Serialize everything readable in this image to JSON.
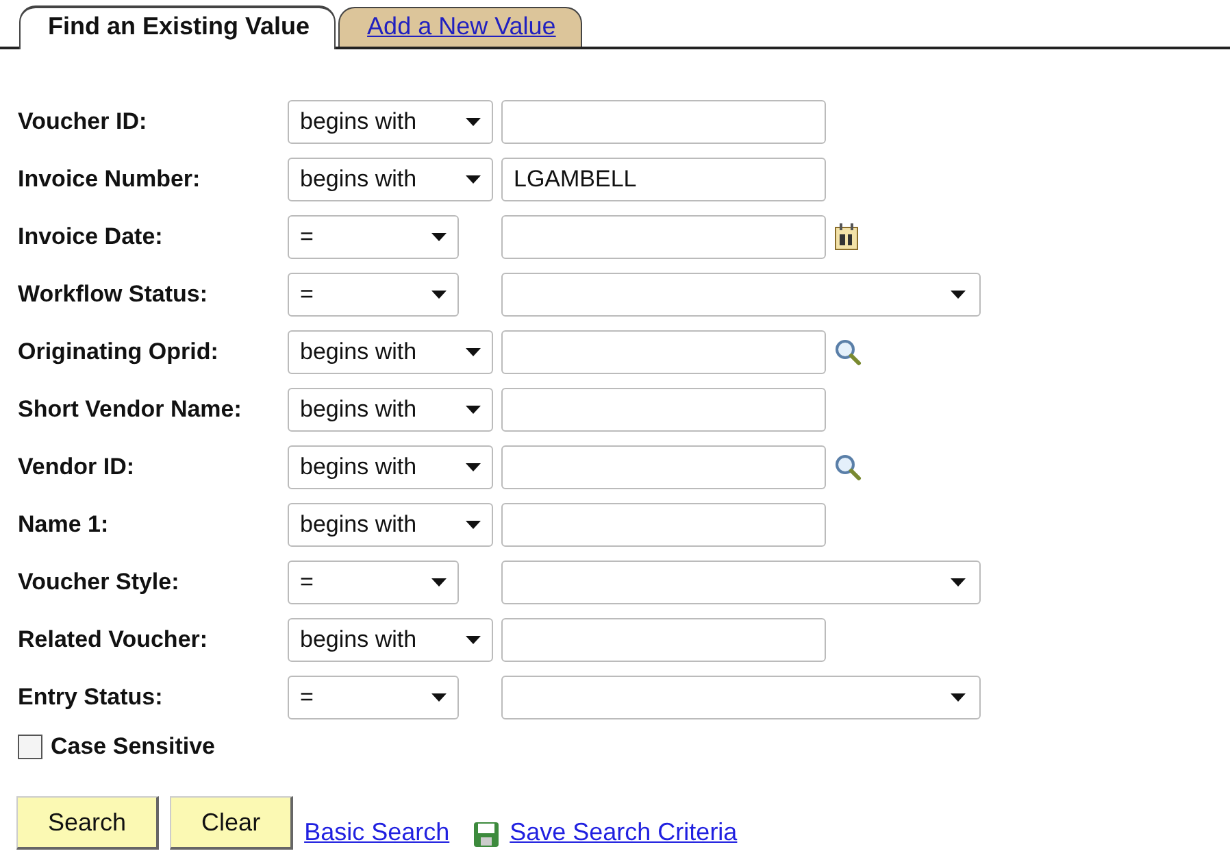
{
  "tabs": [
    {
      "label": "Find an Existing Value",
      "selected": true
    },
    {
      "label": "Add a New Value",
      "selected": false
    }
  ],
  "fields": [
    {
      "label": "Voucher ID:",
      "operator": "begins with",
      "kind": "text"
    },
    {
      "label": "Invoice Number:",
      "operator": "begins with",
      "kind": "text",
      "value": "LGAMBELL"
    },
    {
      "label": "Invoice Date:",
      "operator": "=",
      "kind": "text",
      "calendar": true
    },
    {
      "label": "Workflow Status:",
      "operator": "=",
      "kind": "select"
    },
    {
      "label": "Originating Oprid:",
      "operator": "begins with",
      "kind": "text",
      "lookup": true
    },
    {
      "label": "Short Vendor Name:",
      "operator": "begins with",
      "kind": "text"
    },
    {
      "label": "Vendor ID:",
      "operator": "begins with",
      "kind": "text",
      "lookup": true
    },
    {
      "label": "Name 1:",
      "operator": "begins with",
      "kind": "text"
    },
    {
      "label": "Voucher Style:",
      "operator": "=",
      "kind": "select"
    },
    {
      "label": "Related Voucher:",
      "operator": "begins with",
      "kind": "text"
    },
    {
      "label": "Entry Status:",
      "operator": "=",
      "kind": "select"
    }
  ],
  "case_sensitive": {
    "label": "Case Sensitive",
    "checked": false
  },
  "buttons": [
    "Search",
    "Clear"
  ],
  "links": [
    {
      "label": "Basic Search",
      "kind": "plain"
    },
    {
      "label": "Save Search Criteria",
      "kind": "save"
    }
  ]
}
